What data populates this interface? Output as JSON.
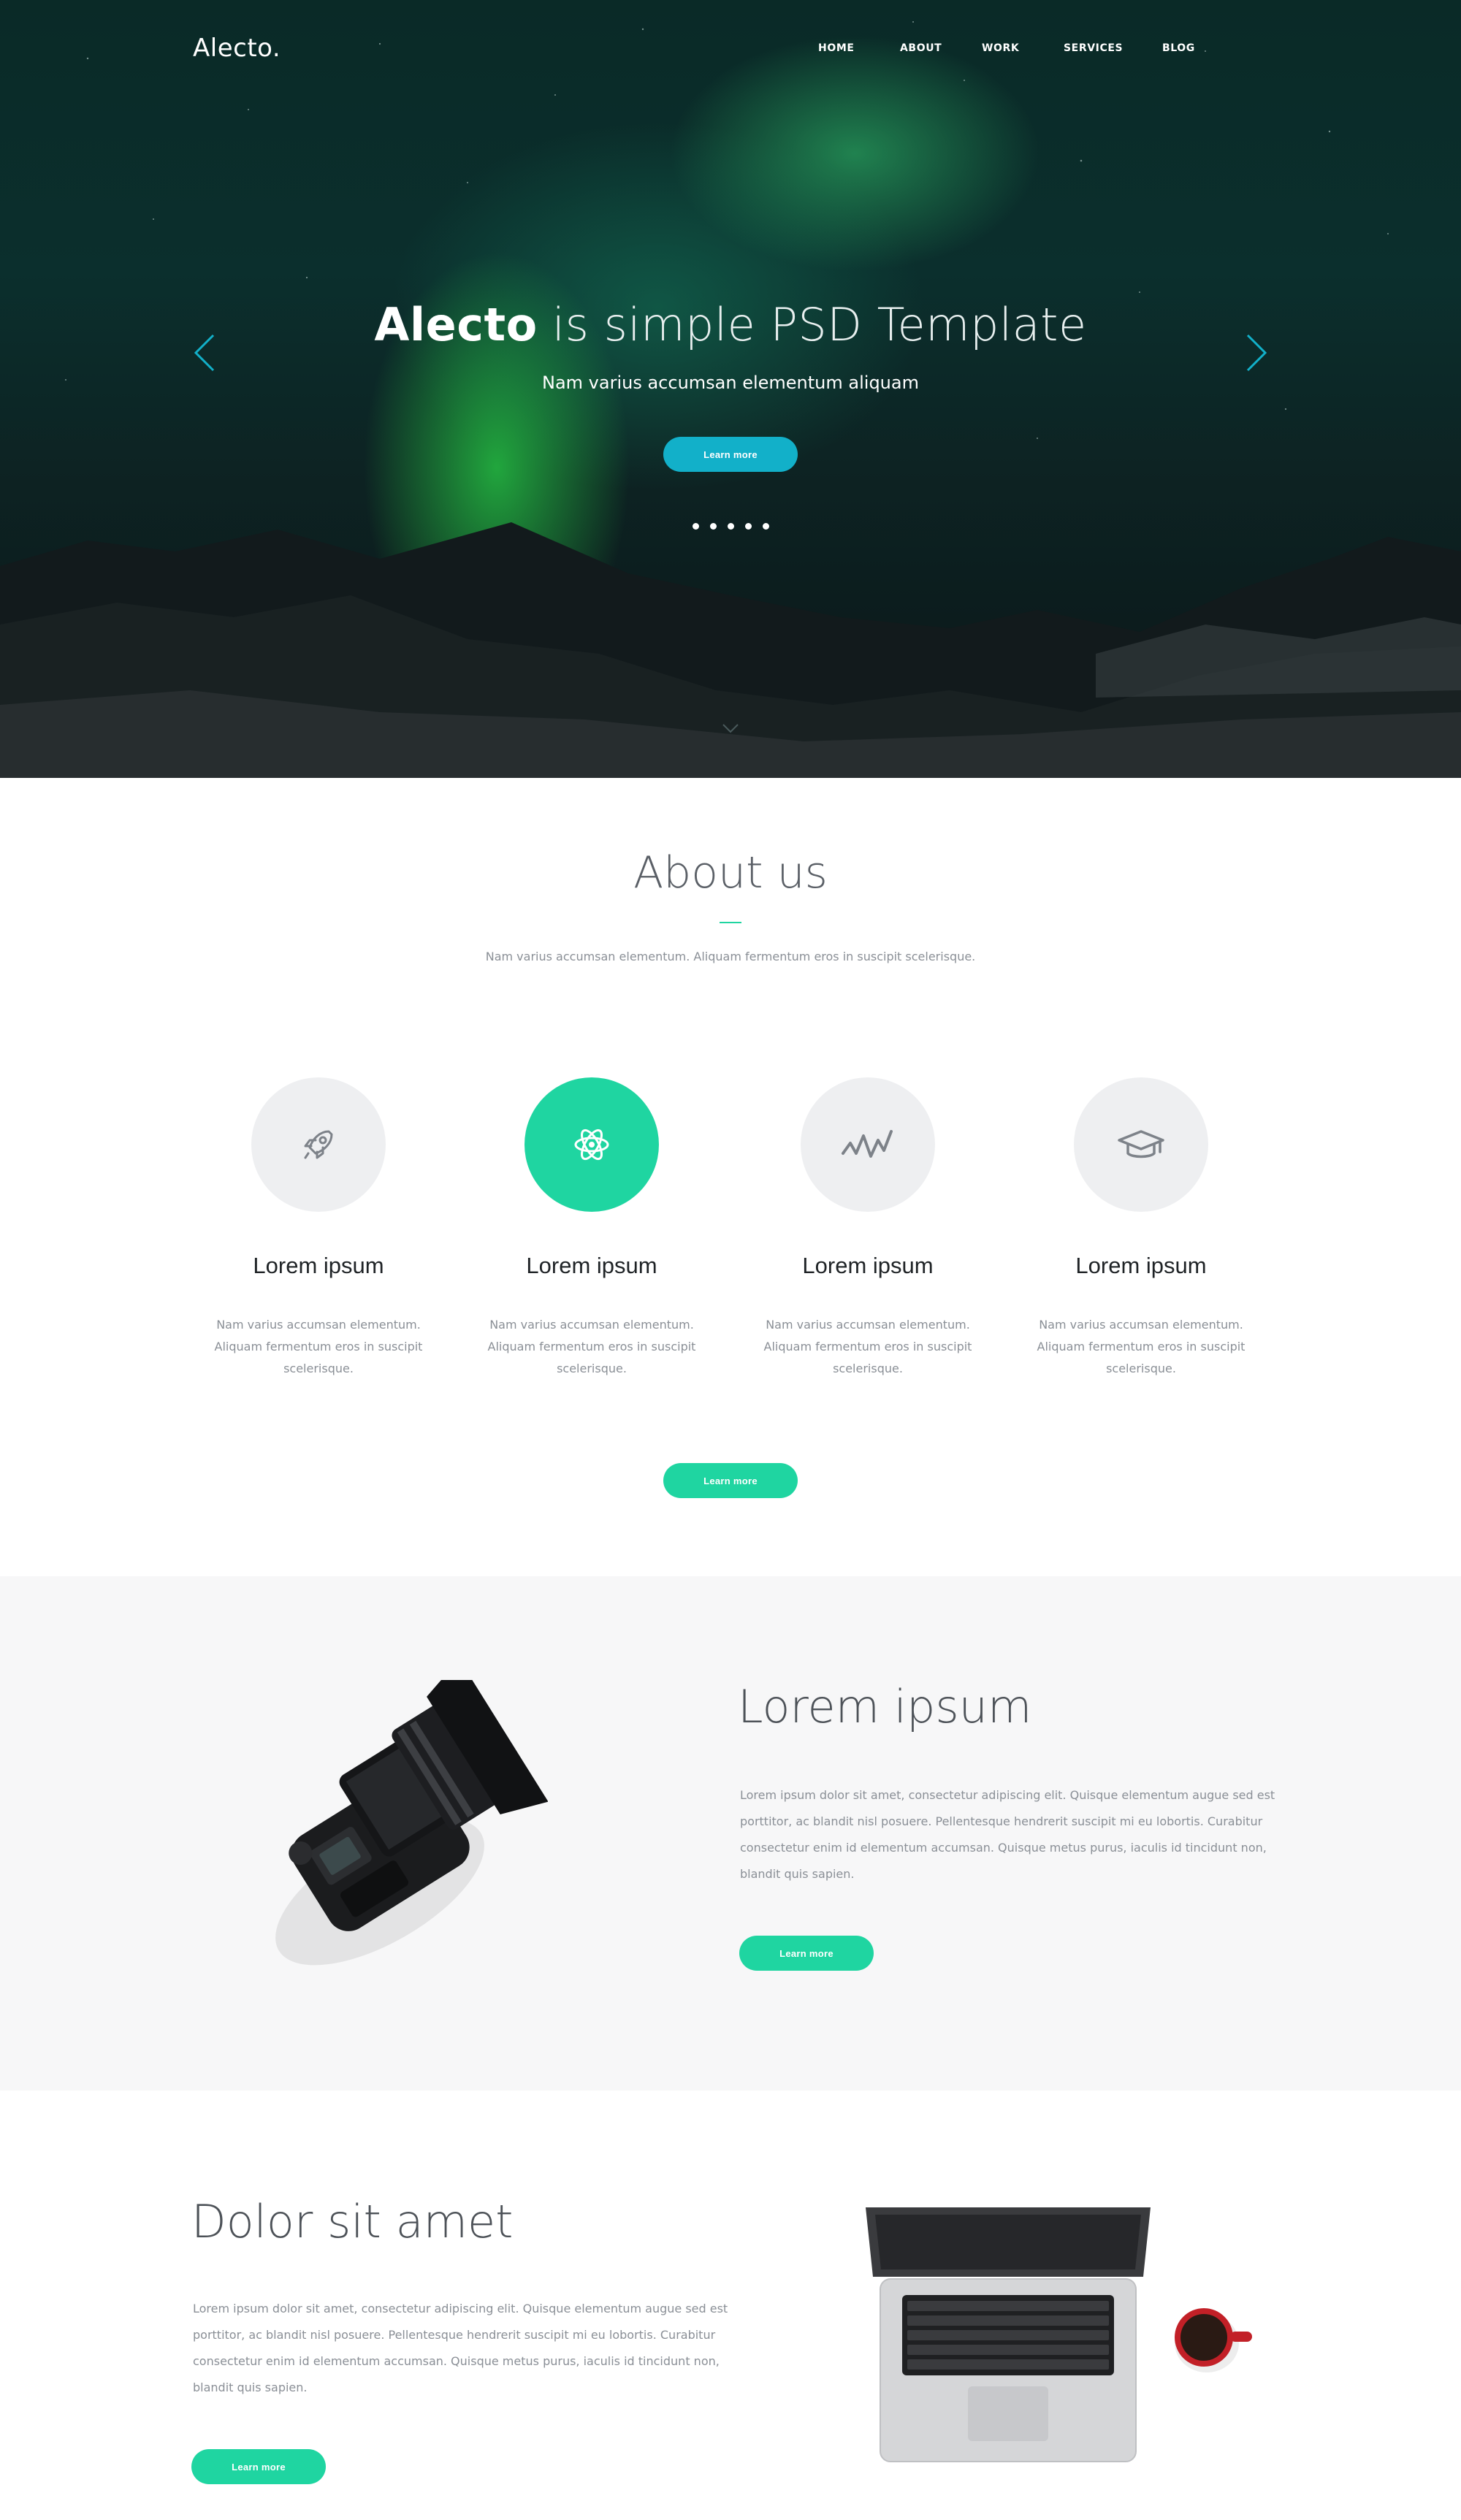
{
  "brand": {
    "logo": "Alecto."
  },
  "nav": {
    "items": [
      "HOME",
      "ABOUT",
      "WORK",
      "SERVICES",
      "BLOG"
    ]
  },
  "hero": {
    "title_bold": "Alecto",
    "title_light": " is simple PSD Template",
    "subtitle": "Nam varius accumsan elementum aliquam",
    "button_label": "Learn more",
    "slide_count": 5
  },
  "about": {
    "title": "About us",
    "lead": "Nam varius accumsan elementum. Aliquam fermentum eros in suscipit scelerisque.",
    "features": [
      {
        "icon": "rocket-icon",
        "title": "Lorem ipsum",
        "text": "Nam varius accumsan elementum. Aliquam fermentum eros in suscipit scelerisque."
      },
      {
        "icon": "atom-icon",
        "title": "Lorem ipsum",
        "text": "Nam varius accumsan elementum. Aliquam fermentum eros in suscipit scelerisque."
      },
      {
        "icon": "pulse-icon",
        "title": "Lorem ipsum",
        "text": "Nam varius accumsan elementum. Aliquam fermentum eros in suscipit scelerisque."
      },
      {
        "icon": "graduation-cap-icon",
        "title": "Lorem ipsum",
        "text": "Nam varius accumsan elementum. Aliquam fermentum eros in suscipit scelerisque."
      }
    ],
    "button_label": "Learn more"
  },
  "section_camera": {
    "title": "Lorem ipsum",
    "text": "Lorem ipsum dolor sit amet, consectetur adipiscing elit. Quisque elementum augue sed est porttitor, ac blandit nisl posuere. Pellentesque hendrerit suscipit mi eu lobortis. Curabitur consectetur enim id elementum accumsan. Quisque metus purus, iaculis id tincidunt non, blandit quis sapien.",
    "button_label": "Learn more"
  },
  "section_laptop": {
    "title": "Dolor sit amet",
    "text": "Lorem ipsum dolor sit amet, consectetur adipiscing elit. Quisque elementum augue sed est porttitor, ac blandit nisl posuere. Pellentesque hendrerit suscipit mi eu lobortis. Curabitur consectetur enim id elementum accumsan. Quisque metus purus, iaculis id tincidunt non, blandit quis sapien.",
    "button_label": "Learn more"
  },
  "colors": {
    "accent_green": "#1fd5a1",
    "accent_cyan": "#12b0c9",
    "text_muted": "#8a8f96",
    "section_gray": "#f7f7f8"
  }
}
